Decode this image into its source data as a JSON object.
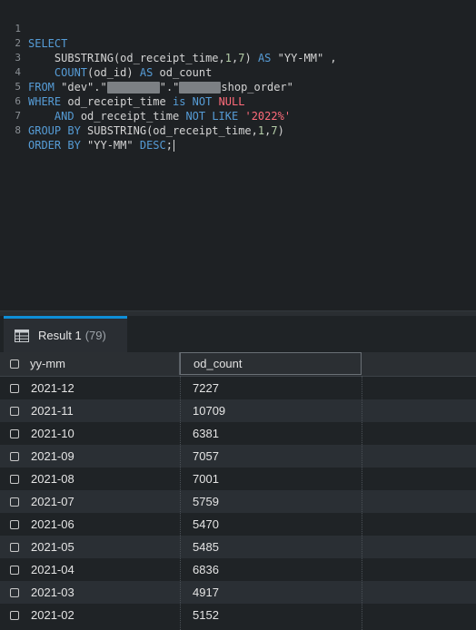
{
  "editor": {
    "lines": [
      {
        "no": "1"
      },
      {
        "no": "2"
      },
      {
        "no": "3"
      },
      {
        "no": "4"
      },
      {
        "no": "5"
      },
      {
        "no": "6"
      },
      {
        "no": "7"
      },
      {
        "no": "8"
      }
    ],
    "l1_select": "SELECT",
    "l2_fn": "SUBSTRING",
    "l2_args_a": "(od_receipt_time,",
    "l2_n1": "1",
    "l2_comma": ",",
    "l2_n2": "7",
    "l2_paren": ")",
    "l2_as": "AS",
    "l2_alias": "\"YY-MM\"",
    "l2_trail": " ,",
    "l3_fn": "COUNT",
    "l3_args": "(od_id)",
    "l3_as": "AS",
    "l3_alias": "od_count",
    "l4_from": "FROM",
    "l4_schema": "\"dev\".\"",
    "l4_mid": "\".\"",
    "l4_table": "shop_order\"",
    "l5_where": "WHERE",
    "l5_col": "od_receipt_time",
    "l5_is": "is",
    "l5_not": "NOT",
    "l5_null": "NULL",
    "l6_and": "AND",
    "l6_col": "od_receipt_time",
    "l6_notlike": "NOT LIKE",
    "l6_pattern": "'2022%'",
    "l7_group": "GROUP BY",
    "l7_fn": "SUBSTRING",
    "l7_args": "(od_receipt_time,",
    "l7_n1": "1",
    "l7_comma": ",",
    "l7_n2": "7",
    "l7_paren": ")",
    "l8_order": "ORDER BY",
    "l8_alias": "\"YY-MM\"",
    "l8_desc": "DESC",
    "l8_semi": ";"
  },
  "results": {
    "tab_label": "Result 1",
    "tab_count": "(79)",
    "tab_icon": "table-grid-icon",
    "columns": [
      "yy-mm",
      "od_count"
    ],
    "rows": [
      [
        "2021-12",
        "7227"
      ],
      [
        "2021-11",
        "10709"
      ],
      [
        "2021-10",
        "6381"
      ],
      [
        "2021-09",
        "7057"
      ],
      [
        "2021-08",
        "7001"
      ],
      [
        "2021-07",
        "5759"
      ],
      [
        "2021-06",
        "5470"
      ],
      [
        "2021-05",
        "5485"
      ],
      [
        "2021-04",
        "6836"
      ],
      [
        "2021-03",
        "4917"
      ],
      [
        "2021-02",
        "5152"
      ]
    ]
  },
  "colors": {
    "keyword": "#569cd6",
    "string_literal": "#ff6b7a",
    "number": "#b5cea8",
    "tab_accent": "#0e8fd8"
  }
}
